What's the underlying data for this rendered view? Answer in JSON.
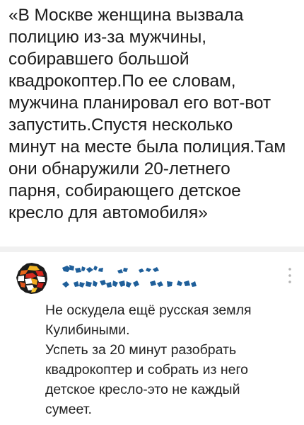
{
  "post": {
    "lines": [
      "«В Москве женщина вызвала",
      "полицию из-за мужчины,",
      "собиравшего большой",
      "квадрокоптер.По ее словам,",
      "мужчина планировал его вот-вот",
      "запустить.Спустя несколько",
      "минут на месте была полиция.Там",
      "они обнаружили 20-летнего",
      "парня, собирающего детское",
      "кресло для автомобиля»"
    ]
  },
  "comment": {
    "avatar_icon": "avatar-icon",
    "author_redacted": true,
    "more_icon": "more-vertical-icon",
    "lines": [
      "Не оскудела ещё русская земля",
      "Кулибиными.",
      "Успеть за 20 минут разобрать",
      "квадрокоптер и собрать из него",
      "детское кресло-это не каждый",
      "сумеет."
    ]
  },
  "colors": {
    "text": "#1c1c1c",
    "divider": "#f1f1f1",
    "redaction": "#1f5f9a",
    "muted_icon": "#b5b5b5"
  }
}
